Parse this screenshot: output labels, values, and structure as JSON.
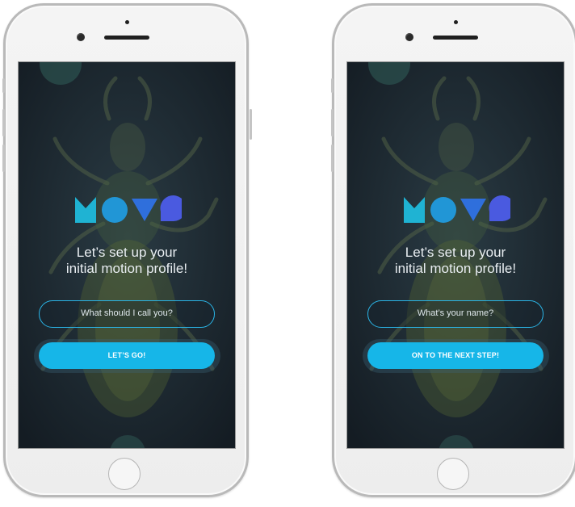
{
  "logo": {
    "text": "MOVE",
    "colors": [
      "#1fb3d3",
      "#2196d6",
      "#2f6fdc",
      "#4a5ae0"
    ]
  },
  "screens": [
    {
      "headline_line1": "Let’s set up your",
      "headline_line2": "initial motion profile!",
      "input_placeholder": "What should I call you?",
      "button_label": "LET’S GO!"
    },
    {
      "headline_line1": "Let’s set up your",
      "headline_line2": "initial motion profile!",
      "input_placeholder": "What’s your name?",
      "button_label": "ON TO THE NEXT STEP!"
    }
  ],
  "colors": {
    "accent": "#16b6e8",
    "screen_bg": "#1b2630",
    "text": "#e9eef2"
  }
}
